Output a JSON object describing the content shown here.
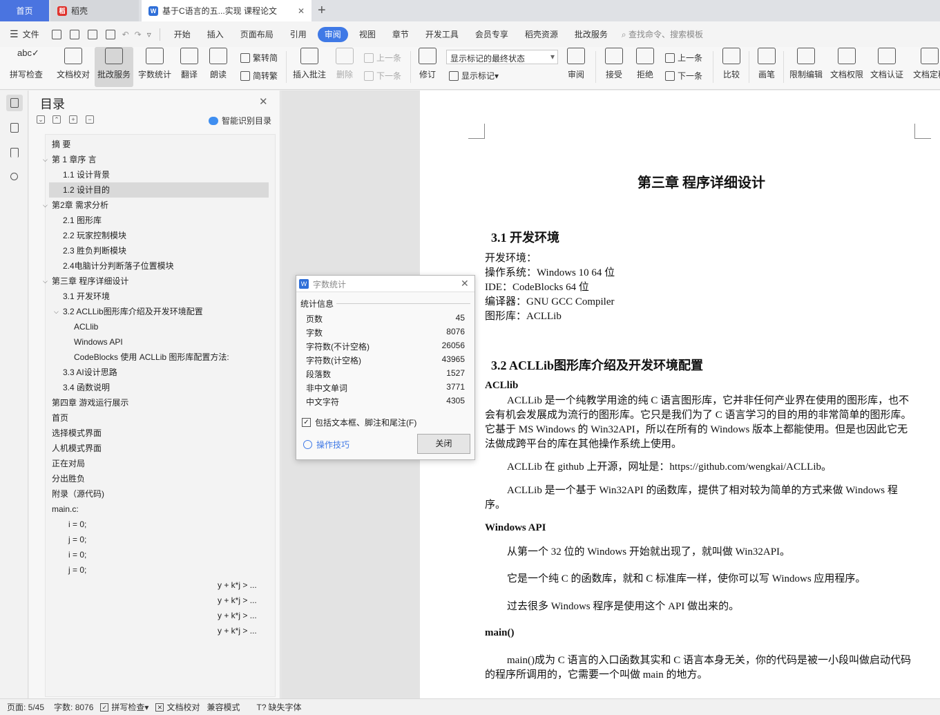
{
  "tabs": {
    "home": "首页",
    "wps": "稻壳",
    "doc": "基于C语言的五...实现 课程论文"
  },
  "menu": {
    "file": "文件",
    "items": [
      "开始",
      "插入",
      "页面布局",
      "引用",
      "审阅",
      "视图",
      "章节",
      "开发工具",
      "会员专享",
      "稻壳资源",
      "批改服务"
    ],
    "active": "审阅",
    "search": "查找命令、搜索模板"
  },
  "ribbon": {
    "spellcheck": "拼写检查",
    "doccheck": "文档校对",
    "review_service": "批改服务",
    "wordcount": "字数统计",
    "translate": "翻译",
    "read": "朗读",
    "trad_simp": "繁转简",
    "simp_trad": "简转繁",
    "insert_comment": "插入批注",
    "delete": "删除",
    "prev": "上一条",
    "next": "下一条",
    "track": "修订",
    "markup_state": "显示标记的最终状态",
    "show_markup": "显示标记",
    "review": "审阅",
    "accept": "接受",
    "reject": "拒绝",
    "prev2": "上一条",
    "next2": "下一条",
    "compare": "比较",
    "pen": "画笔",
    "restrict": "限制编辑",
    "permission": "文档权限",
    "certify": "文档认证",
    "finalize": "文档定稿"
  },
  "toc": {
    "title": "目录",
    "ai": "智能识别目录",
    "items": [
      "摘  要",
      "第 1 章序  言",
      "1.1  设计背景",
      "1.2  设计目的",
      "第2章  需求分析",
      "2.1  图形库",
      "2.2  玩家控制模块",
      "2.3  胜负判断模块",
      "2.4电脑计分判断落子位置模块",
      "第三章  程序详细设计",
      "3.1  开发环境",
      "3.2 ACLLib图形库介绍及开发环境配置",
      "ACLlib",
      "Windows API",
      "CodeBlocks 使用 ACLLib 图形库配置方法:",
      "3.3 AI设计思路",
      "3.4  函数说明",
      "第四章  游戏运行展示",
      "首页",
      "选择模式界面",
      "人机模式界面",
      "正在对局",
      "分出胜负",
      "附录（源代码)",
      "main.c:",
      "i = 0;",
      "j = 0;",
      "i = 0;",
      "j = 0;",
      "y + k*j > ...",
      "y + k*j > ...",
      "y + k*j > ...",
      "y + k*j > ..."
    ]
  },
  "dialog": {
    "title": "字数统计",
    "section": "统计信息",
    "rows": [
      {
        "label": "页数",
        "value": "45"
      },
      {
        "label": "字数",
        "value": "8076"
      },
      {
        "label": "字符数(不计空格)",
        "value": "26056"
      },
      {
        "label": "字符数(计空格)",
        "value": "43965"
      },
      {
        "label": "段落数",
        "value": "1527"
      },
      {
        "label": "非中文单词",
        "value": "3771"
      },
      {
        "label": "中文字符",
        "value": "4305"
      }
    ],
    "include": "包括文本框、脚注和尾注(F)",
    "tips": "操作技巧",
    "close": "关闭"
  },
  "doc": {
    "chapter": "第三章  程序详细设计",
    "s31": "3.1  开发环境",
    "env": [
      "开发环境：",
      "操作系统：Windows 10 64 位",
      "IDE：CodeBlocks 64 位",
      "编译器：GNU GCC Compiler",
      "图形库：ACLLib"
    ],
    "s32": "3.2 ACLLib图形库介绍及开发环境配置",
    "acllib_h": "ACLlib",
    "p1": "ACLLib 是一个纯教学用途的纯 C 语言图形库，它并非任何产业界在使用的图形库，也不会有机会发展成为流行的图形库。它只是我们为了 C 语言学习的目的用的非常简单的图形库。它基于 MS Windows 的 Win32API，所以在所有的 Windows 版本上都能使用。但是也因此它无法做成跨平台的库在其他操作系统上使用。",
    "p2": "ACLLib 在 github 上开源，网址是：https://github.com/wengkai/ACLLib。",
    "p3": "ACLLib 是一个基于 Win32API 的函数库，提供了相对较为简单的方式来做 Windows 程序。",
    "winapi_h": "Windows API",
    "p4": "从第一个 32 位的 Windows 开始就出现了，就叫做 Win32API。",
    "p5": "它是一个纯 C 的函数库，就和 C 标准库一样，使你可以写 Windows 应用程序。",
    "p6": "过去很多 Windows 程序是使用这个 API 做出来的。",
    "main_h": "main()",
    "p7": "main()成为 C 语言的入口函数其实和 C 语言本身无关，你的代码是被一小段叫做启动代码的程序所调用的，它需要一个叫做 main 的地方。"
  },
  "status": {
    "page": "页面: 5/45",
    "words": "字数: 8076",
    "spell": "拼写检查",
    "proof": "文档校对",
    "compat": "兼容模式",
    "font": "缺失字体"
  }
}
